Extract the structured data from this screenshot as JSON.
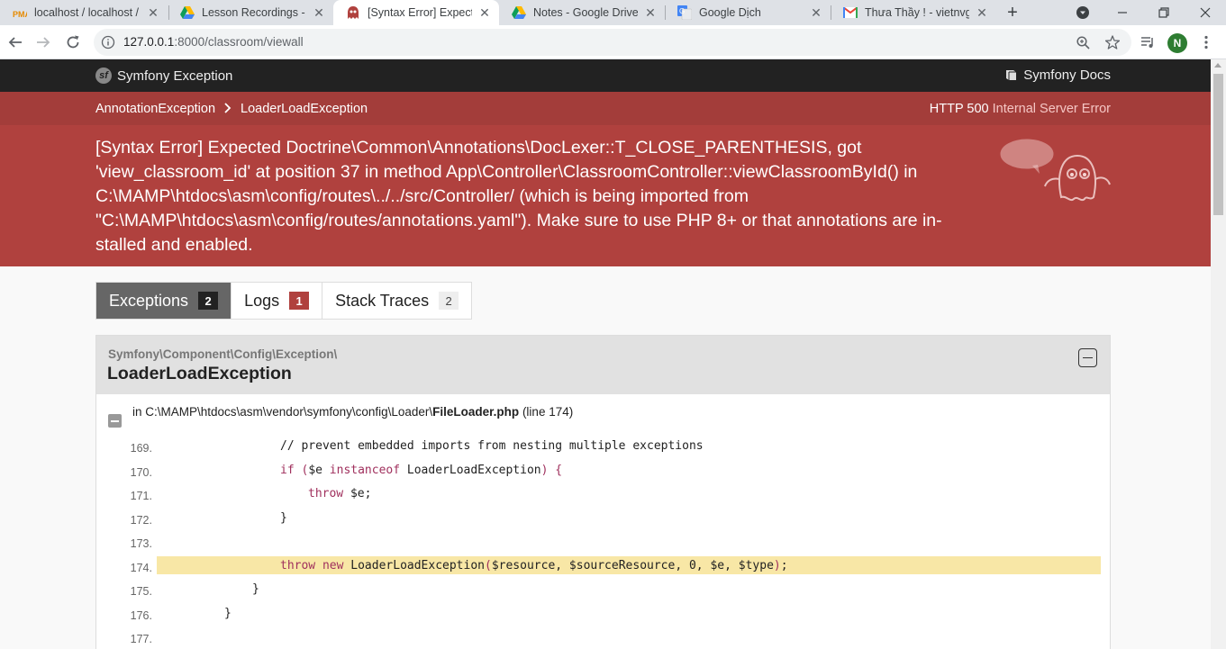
{
  "browser": {
    "tabs": [
      {
        "title": "localhost / localhost / ",
        "icon": "phpmyadmin-icon",
        "active": false
      },
      {
        "title": "Lesson Recordings - G",
        "icon": "google-drive-icon",
        "active": false
      },
      {
        "title": "[Syntax Error] Expecte",
        "icon": "symfony-ghost-icon",
        "active": true
      },
      {
        "title": "Notes - Google Drive",
        "icon": "google-drive-icon",
        "active": false
      },
      {
        "title": "Google Dịch",
        "icon": "google-translate-icon",
        "active": false
      },
      {
        "title": "Thưa Thầy ! - vietnvgc",
        "icon": "gmail-icon",
        "active": false
      }
    ],
    "url_host": "127.0.0.1",
    "url_path": ":8000/classroom/viewall",
    "profile_initial": "N"
  },
  "symfony": {
    "brand": "Symfony Exception",
    "docs": "Symfony Docs",
    "breadcrumbs": [
      "AnnotationException",
      "LoaderLoadException"
    ],
    "status_code": "HTTP 500",
    "status_text": "Internal Server Error",
    "message_lines": [
      "[Syntax Error] Expected Doctrine\\Common\\Annotations\\DocLexer::T_CLOSE_PARENTHESIS, got",
      "'view_classroom_id' at position 37 in method App\\Controller\\ClassroomController::viewClassroomById() in",
      "C:\\MAMP\\htdocs\\asm\\config/routes\\../../src/Controller/ (which is being imported from",
      "\"C:\\MAMP\\htdocs\\asm\\config/routes/annotations.yaml\"). Make sure to use PHP 8+ or that annotations are in-",
      "stalled and enabled."
    ],
    "tabs": [
      {
        "label": "Exceptions",
        "count": "2"
      },
      {
        "label": "Logs",
        "count": "1"
      },
      {
        "label": "Stack Traces",
        "count": "2"
      }
    ],
    "exception_namespace": "Symfony\\Component\\Config\\Exception\\",
    "exception_class": "LoaderLoadException",
    "trace_prefix": "in C:\\MAMP\\htdocs\\asm\\vendor\\symfony\\config\\Loader\\",
    "trace_file": "FileLoader.php",
    "trace_line": "(line 174)",
    "code": [
      {
        "n": "169.",
        "code": "// prevent embedded imports from nesting multiple exceptions"
      },
      {
        "n": "170.",
        "code": "if ($e instanceof LoaderLoadException) {"
      },
      {
        "n": "171.",
        "code": "throw $e;"
      },
      {
        "n": "172.",
        "code": "}"
      },
      {
        "n": "173.",
        "code": ""
      },
      {
        "n": "174.",
        "code": "throw new LoaderLoadException($resource, $sourceResource, 0, $e, $type);"
      },
      {
        "n": "175.",
        "code": "}"
      },
      {
        "n": "176.",
        "code": "}"
      },
      {
        "n": "177.",
        "code": ""
      }
    ]
  }
}
